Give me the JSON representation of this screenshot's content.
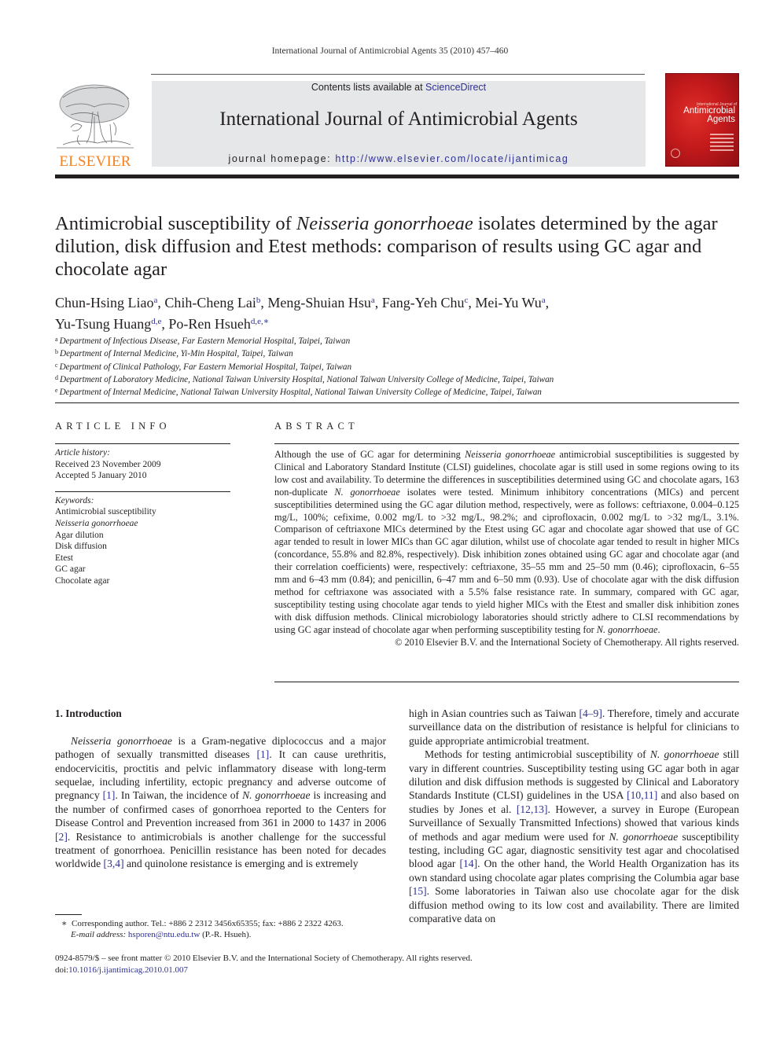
{
  "running_head": "International Journal of Antimicrobial Agents 35 (2010) 457–460",
  "banner": {
    "contents_prefix": "Contents lists available at ",
    "contents_link": "ScienceDirect",
    "journal_title": "International Journal of Antimicrobial Agents",
    "homepage_prefix": "journal homepage: ",
    "homepage_url": "http://www.elsevier.com/locate/ijantimicag"
  },
  "publisher_logo": {
    "word": "ELSEVIER",
    "icon": "elsevier-tree-icon",
    "color": "#f58220"
  },
  "cover": {
    "small_line": "International Journal of",
    "title_line1": "Antimicrobial",
    "title_line2": "Agents",
    "color": "#c41a1c"
  },
  "article": {
    "title_part1": "Antimicrobial susceptibility of ",
    "title_italic": "Neisseria gonorrhoeae",
    "title_part2": " isolates determined by the agar dilution, disk diffusion and Etest methods: comparison of results using GC agar and chocolate agar",
    "authors": [
      {
        "name": "Chun-Hsing Liao",
        "aff": "a",
        "sep": ", "
      },
      {
        "name": "Chih-Cheng Lai",
        "aff": "b",
        "sep": ", "
      },
      {
        "name": "Meng-Shuian Hsu",
        "aff": "a",
        "sep": ", "
      },
      {
        "name": "Fang-Yeh Chu",
        "aff": "c",
        "sep": ", "
      },
      {
        "name": "Mei-Yu Wu",
        "aff": "a",
        "sep": ","
      },
      {
        "name": "Yu-Tsung Huang",
        "aff": "d,e",
        "sep": ", "
      },
      {
        "name": "Po-Ren Hsueh",
        "aff": "d,e,∗",
        "sep": ""
      }
    ],
    "affiliations": [
      {
        "key": "a",
        "text": "Department of Infectious Disease, Far Eastern Memorial Hospital, Taipei, Taiwan"
      },
      {
        "key": "b",
        "text": "Department of Internal Medicine, Yi-Min Hospital, Taipei, Taiwan"
      },
      {
        "key": "c",
        "text": "Department of Clinical Pathology, Far Eastern Memorial Hospital, Taipei, Taiwan"
      },
      {
        "key": "d",
        "text": "Department of Laboratory Medicine, National Taiwan University Hospital, National Taiwan University College of Medicine, Taipei, Taiwan"
      },
      {
        "key": "e",
        "text": "Department of Internal Medicine, National Taiwan University Hospital, National Taiwan University College of Medicine, Taipei, Taiwan"
      }
    ]
  },
  "article_info": {
    "heading": "ARTICLE INFO",
    "history_label": "Article history:",
    "received": "Received 23 November 2009",
    "accepted": "Accepted 5 January 2010",
    "keywords_label": "Keywords:",
    "keywords": [
      {
        "text": "Antimicrobial susceptibility",
        "italic": false
      },
      {
        "text": "Neisseria gonorrhoeae",
        "italic": true
      },
      {
        "text": "Agar dilution",
        "italic": false
      },
      {
        "text": "Disk diffusion",
        "italic": false
      },
      {
        "text": "Etest",
        "italic": false
      },
      {
        "text": "GC agar",
        "italic": false
      },
      {
        "text": "Chocolate agar",
        "italic": false
      }
    ]
  },
  "abstract": {
    "heading": "ABSTRACT",
    "segments": [
      {
        "t": "Although the use of GC agar for determining ",
        "i": false
      },
      {
        "t": "Neisseria gonorrhoeae",
        "i": true
      },
      {
        "t": " antimicrobial susceptibilities is suggested by Clinical and Laboratory Standard Institute (CLSI) guidelines, chocolate agar is still used in some regions owing to its low cost and availability. To determine the differences in susceptibilities determined using GC and chocolate agars, 163 non-duplicate ",
        "i": false
      },
      {
        "t": "N. gonorrhoeae",
        "i": true
      },
      {
        "t": " isolates were tested. Minimum inhibitory concentrations (MICs) and percent susceptibilities determined using the GC agar dilution method, respectively, were as follows: ceftriaxone, 0.004–0.125 mg/L, 100%; cefixime, 0.002 mg/L to >32 mg/L, 98.2%; and ciprofloxacin, 0.002 mg/L to >32 mg/L, 3.1%. Comparison of ceftriaxone MICs determined by the Etest using GC agar and chocolate agar showed that use of GC agar tended to result in lower MICs than GC agar dilution, whilst use of chocolate agar tended to result in higher MICs (concordance, 55.8% and 82.8%, respectively). Disk inhibition zones obtained using GC agar and chocolate agar (and their correlation coefficients) were, respectively: ceftriaxone, 35–55 mm and 25–50 mm (0.46); ciprofloxacin, 6–55 mm and 6–43 mm (0.84); and penicillin, 6–47 mm and 6–50 mm (0.93). Use of chocolate agar with the disk diffusion method for ceftriaxone was associated with a 5.5% false resistance rate. In summary, compared with GC agar, susceptibility testing using chocolate agar tends to yield higher MICs with the Etest and smaller disk inhibition zones with disk diffusion methods. Clinical microbiology laboratories should strictly adhere to CLSI recommendations by using GC agar instead of chocolate agar when performing susceptibility testing for ",
        "i": false
      },
      {
        "t": "N. gonorrhoeae",
        "i": true
      },
      {
        "t": ".",
        "i": false
      }
    ],
    "copyright": "© 2010 Elsevier B.V. and the International Society of Chemotherapy. All rights reserved."
  },
  "introduction": {
    "heading": "1.  Introduction",
    "left_segments": [
      {
        "t": "Neisseria gonorrhoeae",
        "k": "i"
      },
      {
        "t": " is a Gram-negative diplococcus and a major pathogen of sexually transmitted diseases ",
        "k": "n"
      },
      {
        "t": "[1]",
        "k": "r"
      },
      {
        "t": ". It can cause urethritis, endocervicitis, proctitis and pelvic inflammatory disease with long-term sequelae, including infertility, ectopic pregnancy and adverse outcome of pregnancy ",
        "k": "n"
      },
      {
        "t": "[1]",
        "k": "r"
      },
      {
        "t": ". In Taiwan, the incidence of ",
        "k": "n"
      },
      {
        "t": "N. gonorrhoeae",
        "k": "i"
      },
      {
        "t": " is increasing and the number of confirmed cases of gonorrhoea reported to the Centers for Disease Control and Prevention increased from 361 in 2000 to 1437 in 2006 ",
        "k": "n"
      },
      {
        "t": "[2]",
        "k": "r"
      },
      {
        "t": ". Resistance to antimicrobials is another challenge for the successful treatment of gonorrhoea. Penicillin resistance has been noted for decades worldwide ",
        "k": "n"
      },
      {
        "t": "[3,4]",
        "k": "r"
      },
      {
        "t": " and quinolone resistance is emerging and is extremely",
        "k": "n"
      }
    ],
    "right_p1": [
      {
        "t": "high in Asian countries such as Taiwan ",
        "k": "n"
      },
      {
        "t": "[4–9]",
        "k": "r"
      },
      {
        "t": ". Therefore, timely and accurate surveillance data on the distribution of resistance is helpful for clinicians to guide appropriate antimicrobial treatment.",
        "k": "n"
      }
    ],
    "right_p2": [
      {
        "t": "Methods for testing antimicrobial susceptibility of ",
        "k": "n"
      },
      {
        "t": "N. gonorrhoeae",
        "k": "i"
      },
      {
        "t": " still vary in different countries. Susceptibility testing using GC agar both in agar dilution and disk diffusion methods is suggested by Clinical and Laboratory Standards Institute (CLSI) guidelines in the USA ",
        "k": "n"
      },
      {
        "t": "[10,11]",
        "k": "r"
      },
      {
        "t": " and also based on studies by Jones et al. ",
        "k": "n"
      },
      {
        "t": "[12,13]",
        "k": "r"
      },
      {
        "t": ". However, a survey in Europe (European Surveillance of Sexually Transmitted Infections) showed that various kinds of methods and agar medium were used for ",
        "k": "n"
      },
      {
        "t": "N. gonorrhoeae",
        "k": "i"
      },
      {
        "t": " susceptibility testing, including GC agar, diagnostic sensitivity test agar and chocolatised blood agar ",
        "k": "n"
      },
      {
        "t": "[14]",
        "k": "r"
      },
      {
        "t": ". On the other hand, the World Health Organization has its own standard using chocolate agar plates comprising the Columbia agar base ",
        "k": "n"
      },
      {
        "t": "[15]",
        "k": "r"
      },
      {
        "t": ". Some laboratories in Taiwan also use chocolate agar for the disk diffusion method owing to its low cost and availability. There are limited comparative data on",
        "k": "n"
      }
    ]
  },
  "footnote": {
    "marker": "∗",
    "line1": "Corresponding author. Tel.: +886 2 2312 3456x65355; fax: +886 2 2322 4263.",
    "email_label": "E-mail address: ",
    "email": "hsporen@ntu.edu.tw",
    "email_suffix": " (P.-R. Hsueh)."
  },
  "bottom": {
    "issn_line": "0924-8579/$ – see front matter © 2010 Elsevier B.V. and the International Society of Chemotherapy. All rights reserved.",
    "doi_prefix": "doi:",
    "doi": "10.1016/j.ijantimicag.2010.01.007"
  }
}
